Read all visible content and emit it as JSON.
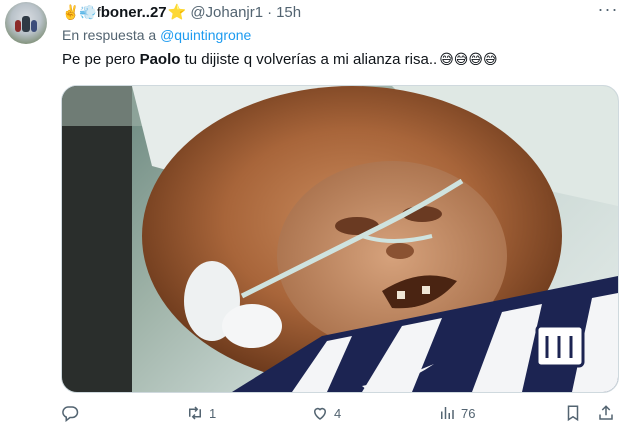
{
  "tweet": {
    "display_name_prefix": "✌️💨f",
    "display_name_main": "boner..27",
    "star": "⭐",
    "handle": "@Johanjr1",
    "separator": "·",
    "time": "15h",
    "more_label": "···"
  },
  "reply_to": {
    "prefix": "En respuesta a",
    "mention": "@quintingrone"
  },
  "body": {
    "before_bold": "Pe pe pero ",
    "bold": "Paolo",
    "after_bold": " tu dijiste q volverías a mi alianza risa..",
    "emojis": "😅😅😅😅"
  },
  "actions": {
    "reply_count": "",
    "retweet_count": "1",
    "like_count": "4",
    "views_count": "76"
  },
  "colors": {
    "link": "#1d9bf0",
    "secondary_text": "#536471",
    "primary_text": "#0f1419"
  }
}
